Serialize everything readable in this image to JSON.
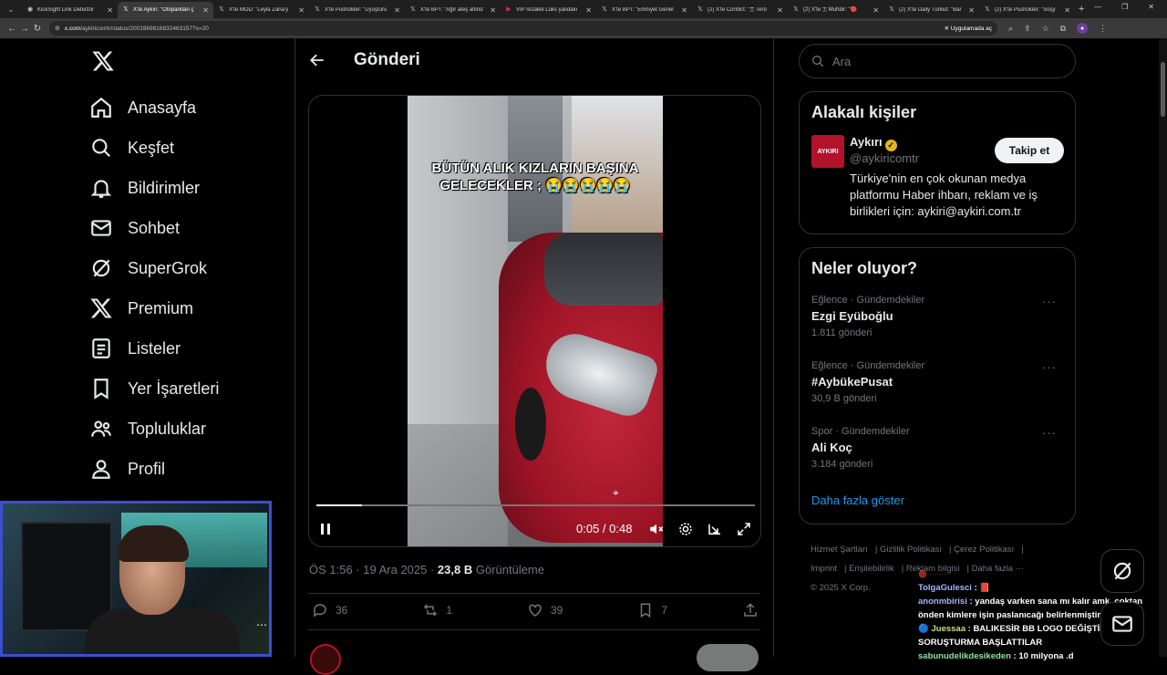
{
  "browser": {
    "tabs": [
      {
        "title": "KickSight Link Detector",
        "active": false
      },
      {
        "title": "X'te Aykırı: \"Otoparktan ç",
        "active": true
      },
      {
        "title": "X'te MOD: \"Leyla Zana'y",
        "active": false
      },
      {
        "title": "X'te Pusholder: \"Uyuşturu",
        "active": false
      },
      {
        "title": "X'te BPT: \"Ağır ateş altınd",
        "active": false
      },
      {
        "title": "VIP rezaleti Lüks yalıdaki",
        "active": false
      },
      {
        "title": "X'te BPT: \"Emniyet Genel",
        "active": false
      },
      {
        "title": "(2) X'te Conflict: \"🇹 Terö",
        "active": false
      },
      {
        "title": "(2) X'te 🇹 Muhbir: \"🔴",
        "active": false
      },
      {
        "title": "(2) X'te Daily Türkist: \"Bar",
        "active": false
      },
      {
        "title": "(2) X'te Pusholder: \"Soşy",
        "active": false
      }
    ],
    "url_domain": "x.com",
    "url_path": "/aykiricomtr/status/2001969816832463157?s=20",
    "app_label": "Uygulamada aç"
  },
  "nav": {
    "items": [
      {
        "label": "Anasayfa",
        "icon": "home-icon"
      },
      {
        "label": "Keşfet",
        "icon": "search-icon"
      },
      {
        "label": "Bildirimler",
        "icon": "bell-icon"
      },
      {
        "label": "Sohbet",
        "icon": "mail-icon"
      },
      {
        "label": "SuperGrok",
        "icon": "grok-icon"
      },
      {
        "label": "Premium",
        "icon": "x-icon"
      },
      {
        "label": "Listeler",
        "icon": "list-icon"
      },
      {
        "label": "Yer İşaretleri",
        "icon": "bookmark-icon"
      },
      {
        "label": "Topluluklar",
        "icon": "communities-icon"
      },
      {
        "label": "Profil",
        "icon": "profile-icon"
      }
    ]
  },
  "post": {
    "header_title": "Gönderi",
    "video_caption": "BÜTÜN ALIK KIZLARIN BAŞINA GELECEKLER ; 😭😭😭😭😭",
    "video_time": "0:05 / 0:48",
    "video_progress": 0.104,
    "time": "ÖS 1:56 · 19 Ara 2025 · ",
    "views_value": "23,8 B",
    "views_label": " Görüntüleme",
    "replies": "36",
    "reposts": "1",
    "likes": "39",
    "bookmarks": "7"
  },
  "sidebar": {
    "search_placeholder": "Ara",
    "related_title": "Alakalı kişiler",
    "person": {
      "name": "Aykırı",
      "handle": "@aykiricomtr",
      "avatar_text": "AYKIRI",
      "bio": "Türkiye'nin en çok okunan medya platformu Haber ihbarı, reklam ve iş birlikleri için: aykiri@aykiri.com.tr",
      "follow_label": "Takip et"
    },
    "trends_title": "Neler oluyor?",
    "trends": [
      {
        "category": "Eğlence · Gündemdekiler",
        "name": "Ezgi Eyüboğlu",
        "count": "1.811 gönderi"
      },
      {
        "category": "Eğlence · Gündemdekiler",
        "name": "#AybükePusat",
        "count": "30,9 B gönderi"
      },
      {
        "category": "Spor · Gündemdekiler",
        "name": "Ali Koç",
        "count": "3.184 gönderi"
      }
    ],
    "show_more": "Daha fazla göster",
    "footer": [
      "Hizmet Şartları",
      "Gizlilik Politikası",
      "Çerez Politikası",
      "Imprint",
      "Erişilebilirlik",
      "Reklam bilgisi",
      "Daha fazla ···",
      "© 2025 X Corp."
    ]
  },
  "chat": [
    {
      "user": "TolgaGulesci",
      "text": ": 📕"
    },
    {
      "user": "anonmbirisi",
      "text": ": yandaş varken sana mı kalır amk, çoktan önden kimlere işin paslanıcağı belirlenmiştir :))"
    },
    {
      "user": "Juessaa",
      "text": ": BALIKESİR BB LOGO DEĞİŞTİRDİ DİYE SORUŞTURMA BAŞLATTILAR"
    },
    {
      "user": "sabunudelikdesikeden",
      "text": ": 10 milyona .d"
    }
  ]
}
